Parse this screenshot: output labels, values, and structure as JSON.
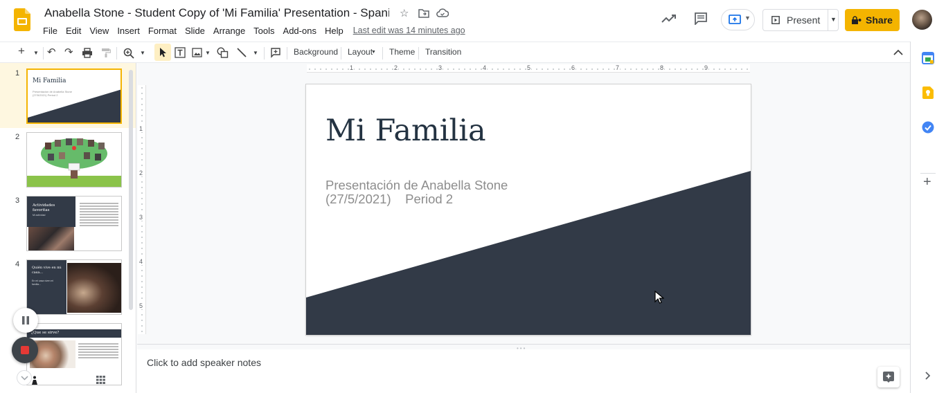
{
  "header": {
    "doc_title": "Anabella Stone - Student Copy of 'Mi Familia' Presentation - Spanish I",
    "menu": [
      "File",
      "Edit",
      "View",
      "Insert",
      "Format",
      "Slide",
      "Arrange",
      "Tools",
      "Add-ons",
      "Help"
    ],
    "last_edit": "Last edit was 14 minutes ago",
    "present_label": "Present",
    "share_label": "Share"
  },
  "toolbar": {
    "background_label": "Background",
    "layout_label": "Layout",
    "theme_label": "Theme",
    "transition_label": "Transition"
  },
  "ruler": {
    "h_labels": [
      "1",
      "2",
      "3",
      "4",
      "5",
      "6",
      "7",
      "8",
      "9"
    ],
    "v_labels": [
      "1",
      "2",
      "3",
      "4",
      "5"
    ]
  },
  "filmstrip": {
    "slide_numbers": [
      "1",
      "2",
      "3",
      "4"
    ],
    "thumb1": {
      "title": "Mi Familia",
      "subtitle": "Presentación de Anabella Stone (27/5/2021)    Period 2"
    },
    "thumb3": {
      "title": "Actividades favoritas",
      "sub": "Mi actividad"
    },
    "thumb4": {
      "title": "Quién vive en mi casa...",
      "body": "En mi casa viven mi familia..."
    },
    "thumb5": {
      "title": "¿Que se sirve?"
    }
  },
  "slide": {
    "title": "Mi Familia",
    "subtitle_line1": "Presentación de Anabella Stone",
    "subtitle_line2": "(27/5/2021)    Period 2"
  },
  "notes": {
    "placeholder": "Click to add speaker notes"
  },
  "colors": {
    "accent_yellow": "#f4b400",
    "slide_dark": "#323a47",
    "title_color": "#243342"
  }
}
